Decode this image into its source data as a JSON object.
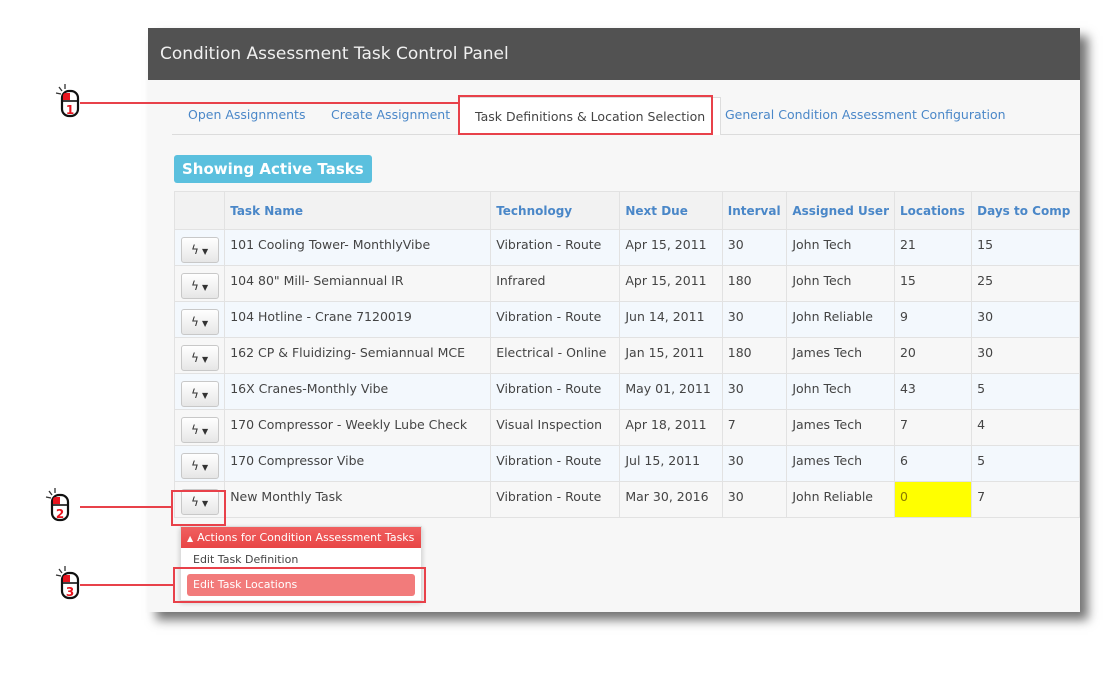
{
  "panel": {
    "title": "Condition Assessment Task Control Panel"
  },
  "tabs": [
    {
      "label": "Open Assignments",
      "active": false
    },
    {
      "label": "Create Assignment",
      "active": false
    },
    {
      "label": "Task Definitions & Location Selection",
      "active": true
    },
    {
      "label": "General Condition Assessment Configuration",
      "active": false
    }
  ],
  "status_badge": "Showing Active Tasks",
  "table": {
    "columns": [
      "",
      "Task Name",
      "Technology",
      "Next Due",
      "Interval",
      "Assigned User",
      "Locations",
      "Days to Comp"
    ],
    "rows": [
      {
        "name": "101 Cooling Tower- MonthlyVibe",
        "technology": "Vibration - Route",
        "next_due": "Apr 15, 2011",
        "interval": "30",
        "user": "John Tech",
        "locations": "21",
        "days": "15"
      },
      {
        "name": "104 80\" Mill- Semiannual IR",
        "technology": "Infrared",
        "next_due": "Apr 15, 2011",
        "interval": "180",
        "user": "John Tech",
        "locations": "15",
        "days": "25"
      },
      {
        "name": "104 Hotline - Crane 7120019",
        "technology": "Vibration - Route",
        "next_due": "Jun 14, 2011",
        "interval": "30",
        "user": "John Reliable",
        "locations": "9",
        "days": "30"
      },
      {
        "name": "162 CP & Fluidizing- Semiannual MCE",
        "technology": "Electrical - Online",
        "next_due": "Jan 15, 2011",
        "interval": "180",
        "user": "James Tech",
        "locations": "20",
        "days": "30"
      },
      {
        "name": "16X Cranes-Monthly Vibe",
        "technology": "Vibration - Route",
        "next_due": "May 01, 2011",
        "interval": "30",
        "user": "John Tech",
        "locations": "43",
        "days": "5"
      },
      {
        "name": "170 Compressor - Weekly Lube Check",
        "technology": "Visual Inspection",
        "next_due": "Apr 18, 2011",
        "interval": "7",
        "user": "James Tech",
        "locations": "7",
        "days": "4"
      },
      {
        "name": "170 Compressor Vibe",
        "technology": "Vibration - Route",
        "next_due": "Jul 15, 2011",
        "interval": "30",
        "user": "James Tech",
        "locations": "6",
        "days": "5"
      },
      {
        "name": "New Monthly Task",
        "technology": "Vibration - Route",
        "next_due": "Mar 30, 2016",
        "interval": "30",
        "user": "John Reliable",
        "locations": "0",
        "days": "7"
      }
    ],
    "action_icon": "bolt-icon",
    "highlight_color": "#ffff00"
  },
  "dropdown": {
    "header": "Actions for Condition Assessment Tasks",
    "items": [
      "Edit Task Definition",
      "Edit Task Locations"
    ],
    "selected": "Edit Task Locations"
  },
  "callouts": [
    {
      "number": "1",
      "target": "Task Definitions & Location Selection tab"
    },
    {
      "number": "2",
      "target": "New Monthly Task action button"
    },
    {
      "number": "3",
      "target": "Edit Task Locations"
    }
  ],
  "colors": {
    "accent": "#e8414a",
    "link": "#4a87c8",
    "badge": "#5bc0de",
    "header": "#525252"
  }
}
